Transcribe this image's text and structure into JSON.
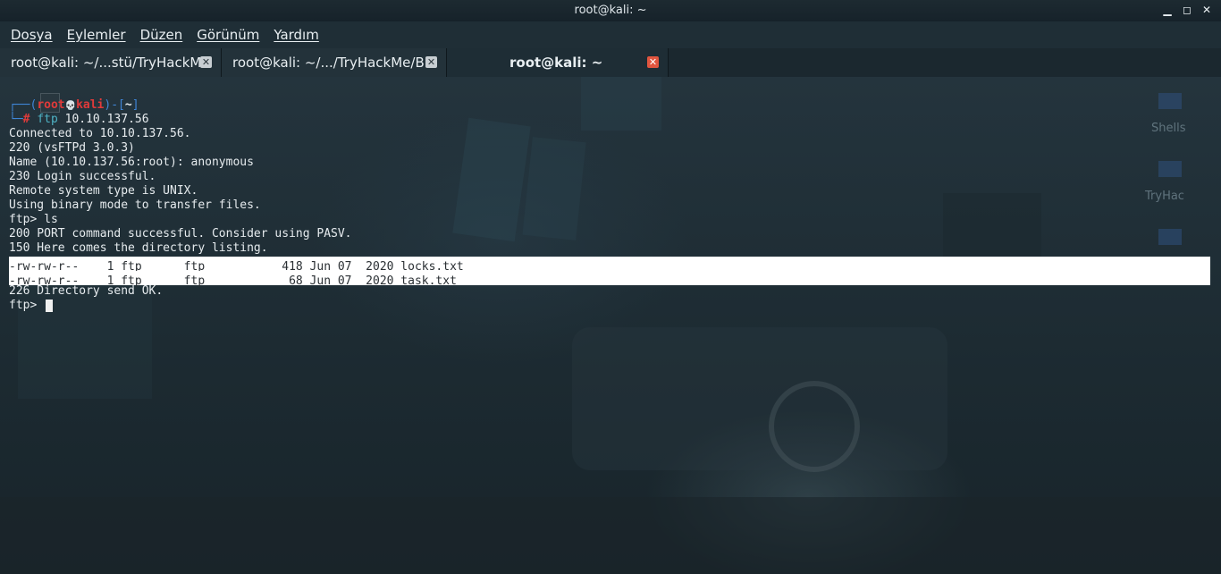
{
  "window": {
    "title": "root@kali: ~"
  },
  "menu": [
    "Dosya",
    "Eylemler",
    "Düzen",
    "Görünüm",
    "Yardım"
  ],
  "tabs": [
    {
      "label": "root@kali: ~/...stü/TryHackMe",
      "active": false
    },
    {
      "label": "root@kali: ~/.../TryHackMe/BH",
      "active": false
    },
    {
      "label": "root@kali: ~",
      "active": true
    }
  ],
  "prompt": {
    "open": "┌──(",
    "user": "root",
    "skull": "💀",
    "host": "kali",
    "mid": ")-[",
    "dir": "~",
    "close": "]",
    "corner": "└─",
    "hash": "#",
    "command": "ftp",
    "arg": "10.10.137.56"
  },
  "output": {
    "line1": "Connected to 10.10.137.56.",
    "line2": "220 (vsFTPd 3.0.3)",
    "line3": "Name (10.10.137.56:root): anonymous",
    "line4": "230 Login successful.",
    "line5": "Remote system type is UNIX.",
    "line6": "Using binary mode to transfer files.",
    "line7": "ftp> ls",
    "line8": "200 PORT command successful. Consider using PASV.",
    "line9": "150 Here comes the directory listing.",
    "file1": "-rw-rw-r--    1 ftp      ftp           418 Jun 07  2020 locks.txt",
    "file2": "-rw-rw-r--    1 ftp      ftp            68 Jun 07  2020 task.txt",
    "line10": "226 Directory send OK.",
    "prompt_final": "ftp> "
  },
  "desktop": {
    "labels": [
      "Shells",
      "TryHac"
    ]
  }
}
